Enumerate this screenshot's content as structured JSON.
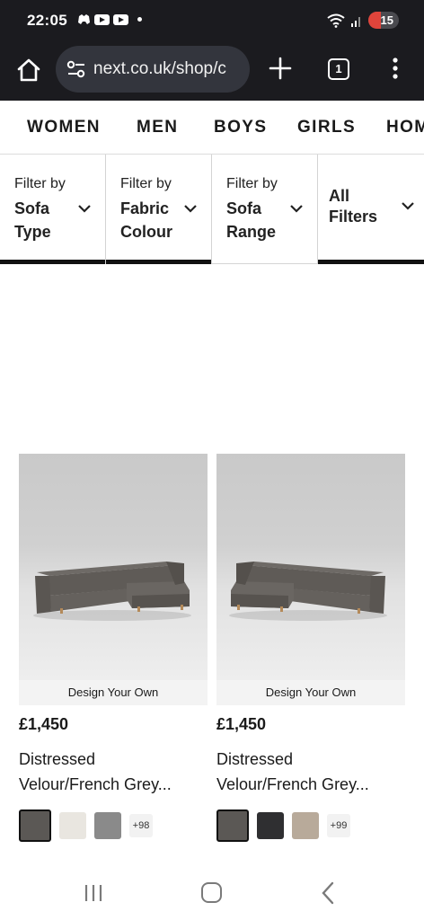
{
  "status_bar": {
    "time": "22:05",
    "battery": "15",
    "icons": [
      "game-controller-icon",
      "youtube-icon",
      "youtube-icon",
      "notification-dot-icon",
      "wifi-icon",
      "signal-icon",
      "battery-icon"
    ]
  },
  "browser": {
    "url": "next.co.uk/shop/c",
    "tab_count": "1",
    "icons": [
      "home-icon",
      "site-settings-icon",
      "plus-icon",
      "tabs-icon",
      "more-vert-icon"
    ]
  },
  "categories": [
    "WOMEN",
    "MEN",
    "BOYS",
    "GIRLS",
    "HOME"
  ],
  "filters": [
    {
      "prefix": "Filter by",
      "label_line1": "Sofa",
      "label_line2": "Type"
    },
    {
      "prefix": "Filter by",
      "label_line1": "Fabric",
      "label_line2": "Colour"
    },
    {
      "prefix": "Filter by",
      "label_line1": "Sofa",
      "label_line2": "Range"
    },
    {
      "prefix": "",
      "label_line1": "All",
      "label_line2": "Filters"
    }
  ],
  "products": [
    {
      "badge": "Design Your Own",
      "price": "£1,450",
      "title_line1": "Distressed",
      "title_line2": "Velour/French Grey...",
      "more_colours": "+98",
      "swatches": [
        "#5b5855",
        "#e9e6e0",
        "#8a8a8a"
      ],
      "sofa_orientation": "chaise-right"
    },
    {
      "badge": "Design Your Own",
      "price": "£1,450",
      "title_line1": "Distressed",
      "title_line2": "Velour/French Grey...",
      "more_colours": "+99",
      "swatches": [
        "#5b5855",
        "#2f2f31",
        "#b8aa9a"
      ],
      "sofa_orientation": "chaise-left"
    }
  ],
  "colors": {
    "dark_chrome": "#1b1b1f",
    "url_pill": "#33353d",
    "accent_text": "#1a1a1a",
    "filter_bar": "#111111"
  }
}
